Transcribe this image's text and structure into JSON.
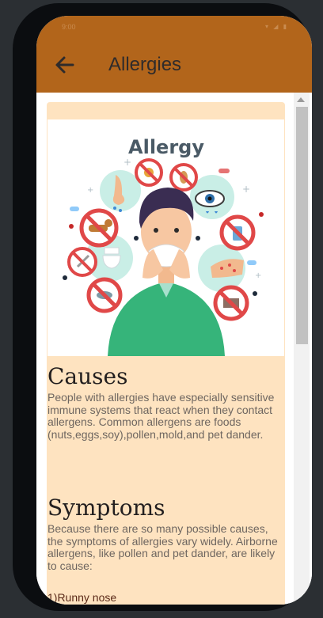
{
  "status": {
    "time": "9:00",
    "icons": "▾ ◢ ▮"
  },
  "appbar": {
    "title": "Allergies",
    "back_icon": "arrow-left-icon"
  },
  "hero": {
    "heading": "Allergy",
    "allergen_icons": [
      "pollen-icon",
      "nose-icon",
      "peanut-icon",
      "pill-icon",
      "eye-icon",
      "dog-icon",
      "spray-icon",
      "toilet-icon",
      "needle-icon",
      "skin-rash-icon",
      "fish-icon",
      "mold-icon"
    ]
  },
  "causes": {
    "title": "Causes",
    "body": "People with allergies have especially sensitive immune systems that react when they contact allergens. Common allergens are foods (nuts,eggs,soy),pollen,mold,and pet dander."
  },
  "symptoms": {
    "title": "Symptoms",
    "body": "Because there are so many possible causes, the symptoms of allergies vary widely. Airborne allergens, like pollen and pet dander, are likely to cause:",
    "items": [
      "1)Runny nose"
    ]
  },
  "colors": {
    "appbar": "#b2651b",
    "card": "#fee3c0",
    "title_text": "#2f2b2b"
  }
}
